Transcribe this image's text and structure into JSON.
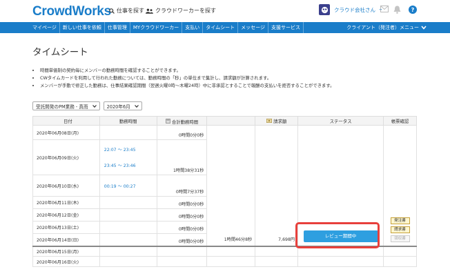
{
  "header": {
    "logo": "CrowdWorks",
    "find_job": "仕事を探す",
    "find_worker": "クラウドワーカーを探す",
    "company": "クラウド会社さん"
  },
  "nav": {
    "items": [
      "マイページ",
      "新しい仕事を依頼",
      "仕事管理",
      "MYクラウドワーカー",
      "支払い",
      "タイムシート",
      "メッセージ",
      "支援サービス"
    ],
    "right": "クライアント（発注者）メニュー"
  },
  "page": {
    "title": "タイムシート",
    "notes": [
      "時間単価制の契約毎にメンバーの勤務時間を確認することができます。",
      "CWタイムカードを利用して行われた勤務については、勤務時間の「秒」の単位まで集計し、請求額が計算されます。",
      "メンバーが手動で修正した勤務は、仕事結果確認期間（翌週火曜0時〜木曜24時）中に非承認とすることで報酬の支払いを拒否することができます。"
    ],
    "select_contract": "受託開発のPM業務 - 真而",
    "select_month": "2020年6月"
  },
  "table": {
    "headers": [
      "日付",
      "勤務時間",
      "合計勤務時間",
      "請求額",
      "ステータス",
      "帳票確認"
    ],
    "rows": [
      {
        "date": "2020年06月08日(月)",
        "times": [],
        "duration": "0時間0分0秒"
      },
      {
        "date": "2020年06月09日(火)",
        "times": [
          "22:07 〜 23:45",
          "23:45 〜 23:46"
        ],
        "duration": "1時間38分31秒"
      },
      {
        "date": "2020年06月10日(水)",
        "times": [
          "00:19 〜 00:27"
        ],
        "duration": "0時間7分37秒"
      },
      {
        "date": "2020年06月11日(木)",
        "times": [],
        "duration": "0時間0分0秒"
      },
      {
        "date": "2020年06月12日(金)",
        "times": [],
        "duration": "0時間0分0秒"
      },
      {
        "date": "2020年06月13日(土)",
        "times": [],
        "duration": "0時間0分0秒"
      },
      {
        "date": "2020年06月14日(日)",
        "times": [],
        "duration": "0時間0分0秒"
      }
    ],
    "total_duration": "1時間46分8秒",
    "amount": "7,698円",
    "status_button": "レビュー期間中",
    "ledger": [
      "発注書",
      "請求書",
      "領収書"
    ],
    "next_rows": [
      "2020年06月15日(月)",
      "2020年06月16日(火)"
    ]
  }
}
